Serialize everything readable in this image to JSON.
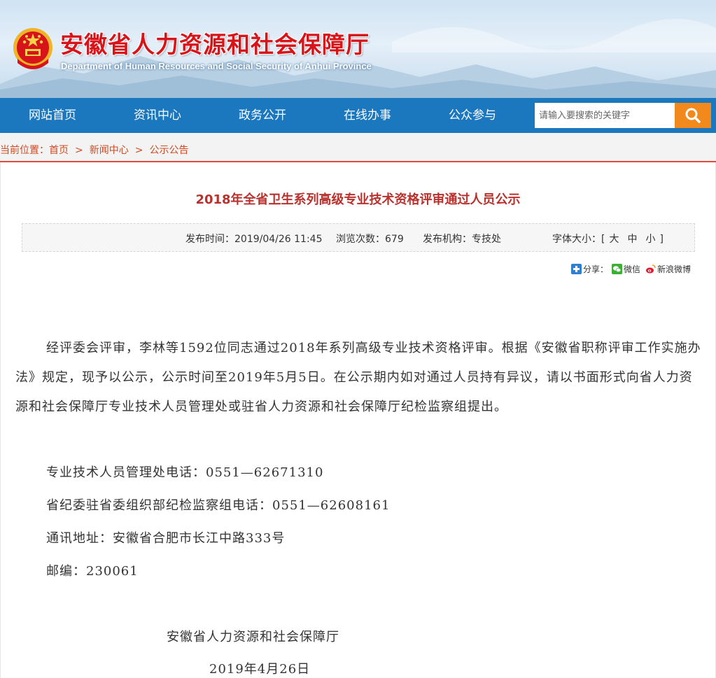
{
  "header": {
    "title": "安徽省人力资源和社会保障厅",
    "subtitle": "Department of Human Resources and Social Security of Anhui Province"
  },
  "nav": {
    "items": [
      "网站首页",
      "资讯中心",
      "政务公开",
      "在线办事",
      "公众参与"
    ],
    "search_placeholder": "请输入要搜索的关键字"
  },
  "breadcrumb": {
    "prefix": "当前位置：",
    "items": [
      "首页",
      "新闻中心",
      "公示公告"
    ],
    "separator": ">"
  },
  "article": {
    "title": "2018年全省卫生系列高级专业技术资格评审通过人员公示",
    "meta": {
      "publish_time": "发布时间：2019/04/26 11:45",
      "views": "浏览次数：679",
      "org": "发布机构：专技处",
      "font_size_label": "字体大小：[",
      "font_sizes": [
        "大",
        "中",
        "小"
      ],
      "font_size_end": "]"
    },
    "share": {
      "label": "分享：",
      "wechat": "微信",
      "weibo": "新浪微博"
    },
    "body": "经评委会评审，李林等1592位同志通过2018年系列高级专业技术资格评审。根据《安徽省职称评审工作实施办法》规定，现予以公示，公示时间至2019年5月5日。在公示期内如对通过人员持有异议，请以书面形式向省人力资源和社会保障厅专业技术人员管理处或驻省人力资源和社会保障厅纪检监察组提出。",
    "contacts": [
      "专业技术人员管理处电话：0551—62671310",
      "省纪委驻省委组织部纪检监察组电话：0551—62608161",
      "通讯地址：安徽省合肥市长江中路333号",
      "邮编：230061"
    ],
    "signature": "安徽省人力资源和社会保障厅",
    "date": "2019年4月26日"
  },
  "colors": {
    "nav_bg": "#1b78bf",
    "search_button": "#f2891d",
    "title_red": "#d8141b",
    "article_title": "#b8312d",
    "breadcrumb": "#cc4b22"
  }
}
